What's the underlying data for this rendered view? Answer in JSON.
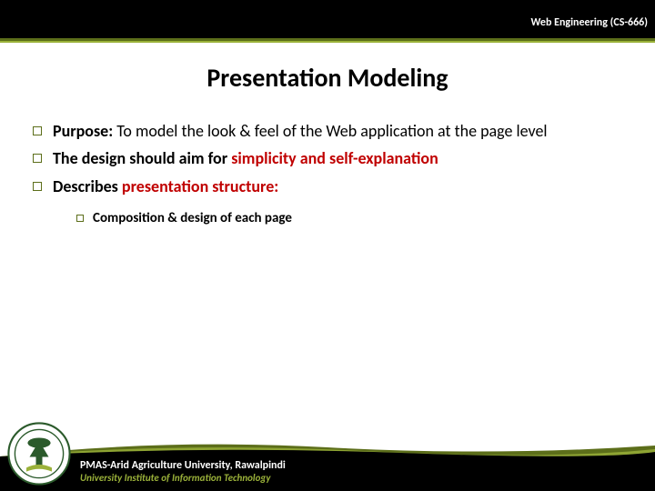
{
  "header": {
    "course_label": "Web Engineering (CS-666)"
  },
  "title": "Presentation Modeling",
  "bullets": [
    {
      "lead": "Purpose:",
      "rest": " To model the look & feel of the Web application at the page level"
    },
    {
      "pre": "The design should aim for ",
      "hl": "simplicity and self-explanation",
      "post": ""
    },
    {
      "pre": "Describes ",
      "hl": "presentation structure:",
      "post": ""
    }
  ],
  "sub_bullets": [
    "Composition & design of each page"
  ],
  "footer": {
    "line1": "PMAS-Arid Agriculture University, Rawalpindi",
    "line2": "University Institute of Information Technology"
  }
}
